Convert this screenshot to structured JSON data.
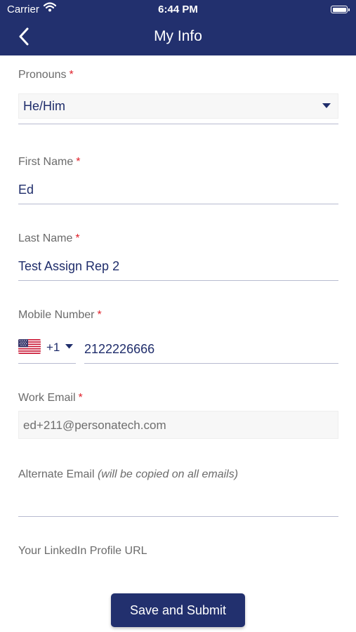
{
  "status_bar": {
    "carrier": "Carrier",
    "time": "6:44 PM"
  },
  "nav": {
    "title": "My Info"
  },
  "form": {
    "pronouns": {
      "label": "Pronouns",
      "required_mark": "*",
      "value": "He/Him"
    },
    "first_name": {
      "label": "First Name",
      "required_mark": "*",
      "value": "Ed"
    },
    "last_name": {
      "label": "Last Name",
      "required_mark": "*",
      "value": "Test Assign Rep 2"
    },
    "mobile_number": {
      "label": "Mobile Number",
      "required_mark": "*",
      "country_code": "+1",
      "value": "2122226666"
    },
    "work_email": {
      "label": "Work Email",
      "required_mark": "*",
      "value": "ed+211@personatech.com"
    },
    "alternate_email": {
      "label": "Alternate Email",
      "hint": "(will be copied on all emails)",
      "value": ""
    },
    "linkedin": {
      "label": "Your LinkedIn Profile URL",
      "value": ""
    }
  },
  "submit_button": {
    "label": "Save and Submit"
  },
  "colors": {
    "header": "#22306e",
    "value_text": "#1f2d6b",
    "required": "#e0202a",
    "underline": "#b7bbd0"
  },
  "icons": {
    "back": "chevron-left-icon",
    "dropdown": "chevron-down-icon",
    "flag": "us-flag-icon",
    "wifi": "wifi-icon",
    "battery": "battery-icon"
  }
}
